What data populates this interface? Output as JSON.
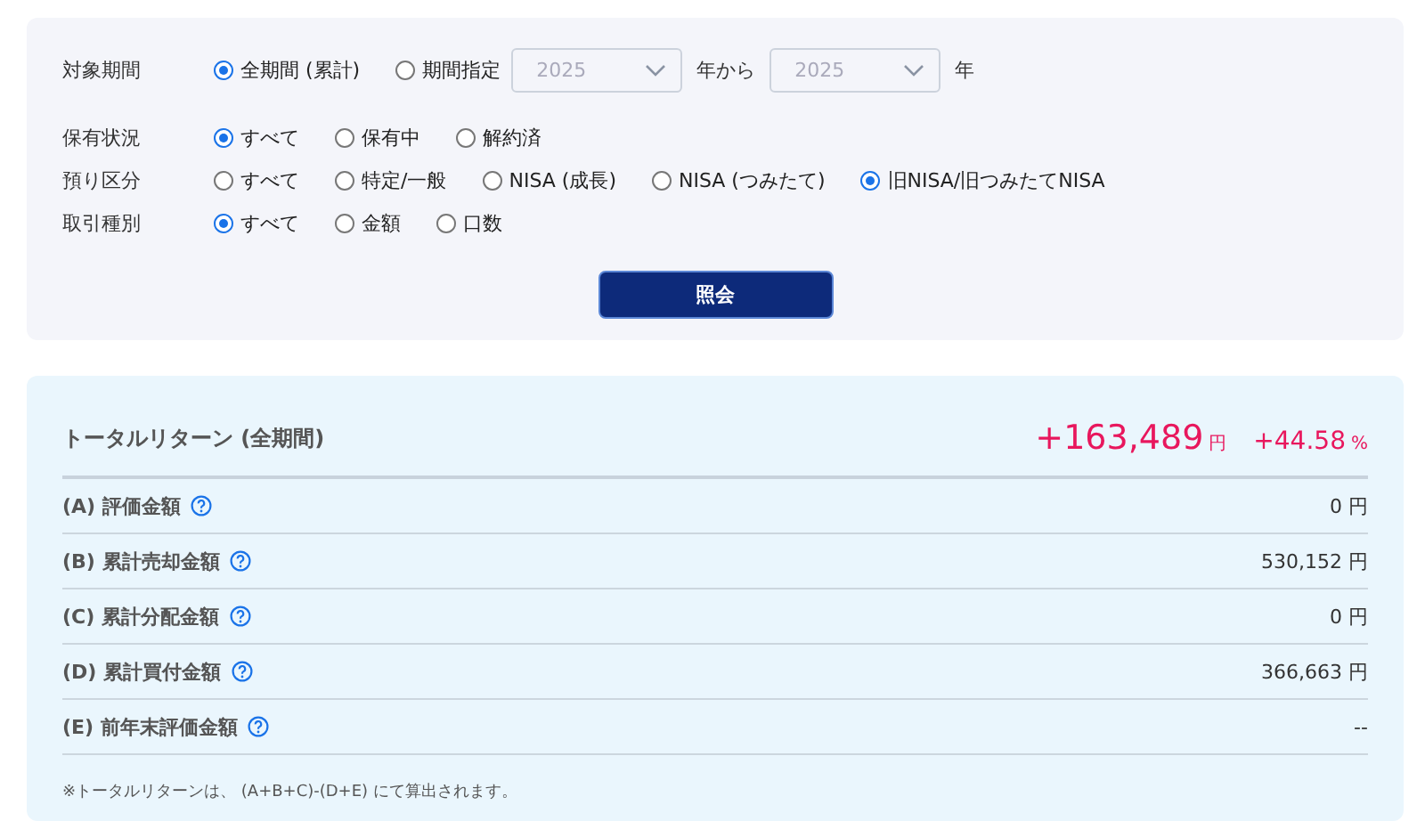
{
  "filters": {
    "period": {
      "label": "対象期間",
      "options": [
        {
          "label": "全期間 (累計)",
          "selected": true
        },
        {
          "label": "期間指定",
          "selected": false
        }
      ],
      "from": {
        "value": "2025",
        "disabled": true
      },
      "from_suffix": "年から",
      "to": {
        "value": "2025",
        "disabled": true
      },
      "to_suffix": "年"
    },
    "rows": [
      {
        "label": "保有状況",
        "options": [
          {
            "label": "すべて",
            "selected": true
          },
          {
            "label": "保有中",
            "selected": false
          },
          {
            "label": "解約済",
            "selected": false
          }
        ]
      },
      {
        "label": "預り区分",
        "options": [
          {
            "label": "すべて",
            "selected": false
          },
          {
            "label": "特定/一般",
            "selected": false
          },
          {
            "label": "NISA (成長)",
            "selected": false
          },
          {
            "label": "NISA (つみたて)",
            "selected": false
          },
          {
            "label": "旧NISA/旧つみたてNISA",
            "selected": true
          }
        ]
      },
      {
        "label": "取引種別",
        "options": [
          {
            "label": "すべて",
            "selected": true
          },
          {
            "label": "金額",
            "selected": false
          },
          {
            "label": "口数",
            "selected": false
          }
        ]
      }
    ],
    "submit": "照会"
  },
  "summary": {
    "title": "トータルリターン (全期間)",
    "amount": "+163,489",
    "amount_unit": "円",
    "rate": "+44.58",
    "rate_unit": "%",
    "rows": [
      {
        "label": "(A) 評価金額",
        "value": "0 円"
      },
      {
        "label": "(B) 累計売却金額",
        "value": "530,152 円"
      },
      {
        "label": "(C) 累計分配金額",
        "value": "0 円"
      },
      {
        "label": "(D) 累計買付金額",
        "value": "366,663 円"
      },
      {
        "label": "(E) 前年末評価金額",
        "value": "--"
      }
    ],
    "note": "※トータルリターンは、 (A+B+C)-(D+E) にて算出されます。"
  }
}
